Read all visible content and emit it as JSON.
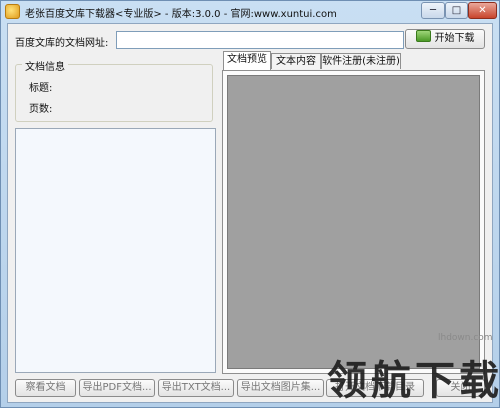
{
  "window": {
    "title": "老张百度文库下载器<专业版> - 版本:3.0.0 - 官网:www.xuntui.com",
    "min_glyph": "─",
    "max_glyph": "□",
    "close_glyph": "✕"
  },
  "url_bar": {
    "label": "百度文库的文档网址:",
    "value": "",
    "download_label": "开始下载"
  },
  "doc_info": {
    "group_title": "文档信息",
    "title_label": "标题:",
    "pages_label": "页数:"
  },
  "tabs": [
    {
      "label": "文档预览",
      "active": true
    },
    {
      "label": "文本内容",
      "active": false
    },
    {
      "label": "软件注册(未注册)",
      "active": false
    }
  ],
  "bottom_buttons": [
    {
      "label": "察看文档"
    },
    {
      "label": "导出PDF文档..."
    },
    {
      "label": "导出TXT文档..."
    },
    {
      "label": "导出文档图片集..."
    },
    {
      "label": "打开文档下载目录"
    },
    {
      "label": "关闭"
    }
  ],
  "watermark": {
    "url": "lhdown.com",
    "text": "领航下载"
  }
}
